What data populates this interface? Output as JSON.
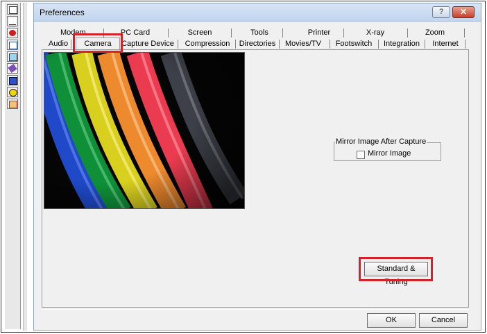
{
  "window": {
    "title": "Preferences",
    "help_label": "?",
    "close_label": "✕"
  },
  "tabs_row1": [
    "Modem",
    "PC Card",
    "Screen",
    "Tools",
    "Printer",
    "X-ray",
    "Zoom"
  ],
  "tabs_row2": [
    "Audio",
    "Camera",
    "Capture Device",
    "Compression",
    "Directories",
    "Movies/TV",
    "Footswitch",
    "Integration",
    "Internet"
  ],
  "active_tab": "Camera",
  "mirror_group": {
    "title": "Mirror Image After Capture",
    "checkbox_label": "Mirror Image",
    "checked": false
  },
  "buttons": {
    "standard_tuning": "Standard & Tuning",
    "ok": "OK",
    "cancel": "Cancel"
  },
  "toolbar_icons": [
    "mail-icon",
    "teeth-icon",
    "lips-icon",
    "document-icon",
    "tv-icon",
    "eraser-icon",
    "monitor-icon",
    "radiation-icon",
    "chart-icon"
  ],
  "colors": {
    "highlight": "#d2232a",
    "close": "#c6412d"
  }
}
